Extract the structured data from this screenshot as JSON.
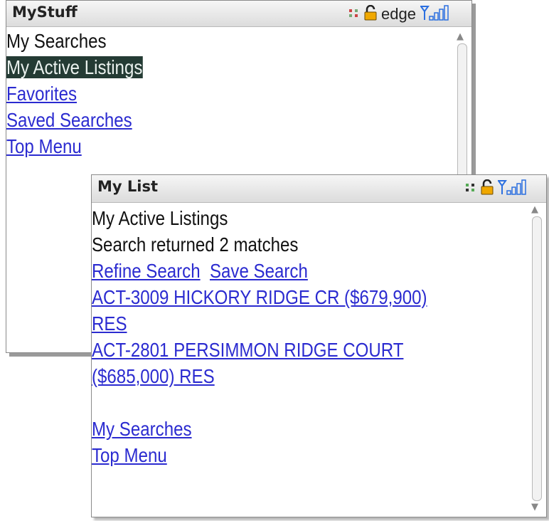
{
  "window_back": {
    "title": "MyStuff",
    "status": {
      "network_label": "edge"
    },
    "items": [
      "My Searches",
      "My Active Listings",
      "Favorites",
      "Saved Searches",
      "Top Menu"
    ]
  },
  "window_front": {
    "title": "My List",
    "heading": "My Active Listings",
    "result_text": "Search returned 2 matches",
    "actions": {
      "refine": "Refine Search",
      "save": "Save Search"
    },
    "listings": [
      {
        "line1": "ACT-3009 HICKORY RIDGE CR ($679,900)",
        "line2": "RES"
      },
      {
        "line1": "ACT-2801 PERSIMMON RIDGE COURT",
        "line2": "($685,000) RES"
      }
    ],
    "links": [
      "My Searches",
      "Top Menu"
    ]
  },
  "colors": {
    "link": "#2b2bd0",
    "selection_bg": "#243b34",
    "title_text": "#222222",
    "signal_icon": "#2b6fe0",
    "lock_icon": "#f0a800"
  },
  "icons": [
    "network-activity-icon",
    "lock-icon",
    "signal-strength-icon",
    "scroll-up-arrow-icon",
    "scroll-down-arrow-icon"
  ]
}
